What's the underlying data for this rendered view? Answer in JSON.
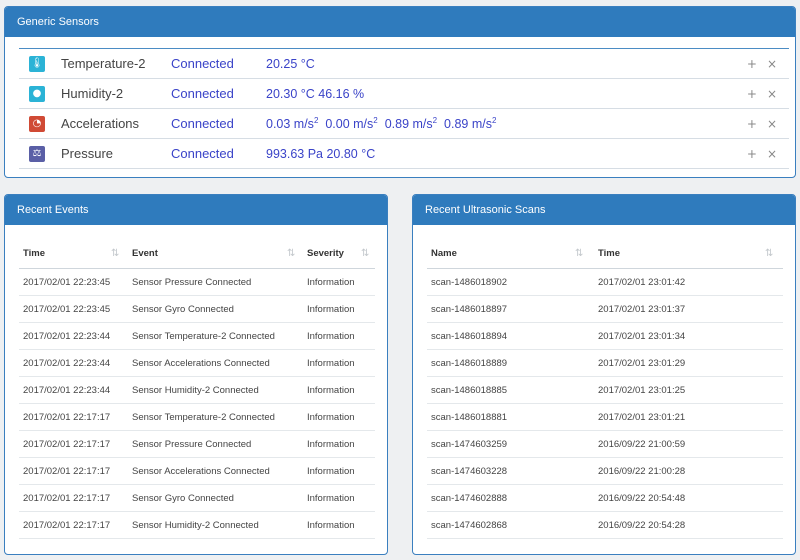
{
  "sensors_panel": {
    "title": "Generic Sensors",
    "rows": [
      {
        "name": "Temperature-2",
        "status": "Connected",
        "value": "20.25 °C",
        "icon": "thermometer-icon"
      },
      {
        "name": "Humidity-2",
        "status": "Connected",
        "value": "20.30 °C  46.16 %",
        "icon": "droplet-icon"
      },
      {
        "name": "Accelerations",
        "status": "Connected",
        "value_parts": [
          "0.03 m/s",
          "0.00 m/s",
          "0.89 m/s",
          "0.89 m/s"
        ],
        "value_sup": "2",
        "icon": "gauge-icon"
      },
      {
        "name": "Pressure",
        "status": "Connected",
        "value": "993.63 Pa  20.80 °C",
        "icon": "scale-icon"
      }
    ],
    "actions": {
      "add": "+",
      "close": "×"
    }
  },
  "events_panel": {
    "title": "Recent Events",
    "columns": [
      "Time",
      "Event",
      "Severity"
    ],
    "rows": [
      [
        "2017/02/01 22:23:45",
        "Sensor Pressure Connected",
        "Information"
      ],
      [
        "2017/02/01 22:23:45",
        "Sensor Gyro Connected",
        "Information"
      ],
      [
        "2017/02/01 22:23:44",
        "Sensor Temperature-2 Connected",
        "Information"
      ],
      [
        "2017/02/01 22:23:44",
        "Sensor Accelerations Connected",
        "Information"
      ],
      [
        "2017/02/01 22:23:44",
        "Sensor Humidity-2 Connected",
        "Information"
      ],
      [
        "2017/02/01 22:17:17",
        "Sensor Temperature-2 Connected",
        "Information"
      ],
      [
        "2017/02/01 22:17:17",
        "Sensor Pressure Connected",
        "Information"
      ],
      [
        "2017/02/01 22:17:17",
        "Sensor Accelerations Connected",
        "Information"
      ],
      [
        "2017/02/01 22:17:17",
        "Sensor Gyro Connected",
        "Information"
      ],
      [
        "2017/02/01 22:17:17",
        "Sensor Humidity-2 Connected",
        "Information"
      ]
    ]
  },
  "scans_panel": {
    "title": "Recent Ultrasonic Scans",
    "columns": [
      "Name",
      "Time"
    ],
    "rows": [
      [
        "scan-1486018902",
        "2017/02/01 23:01:42"
      ],
      [
        "scan-1486018897",
        "2017/02/01 23:01:37"
      ],
      [
        "scan-1486018894",
        "2017/02/01 23:01:34"
      ],
      [
        "scan-1486018889",
        "2017/02/01 23:01:29"
      ],
      [
        "scan-1486018885",
        "2017/02/01 23:01:25"
      ],
      [
        "scan-1486018881",
        "2017/02/01 23:01:21"
      ],
      [
        "scan-1474603259",
        "2016/09/22 21:00:59"
      ],
      [
        "scan-1474603228",
        "2016/09/22 21:00:28"
      ],
      [
        "scan-1474602888",
        "2016/09/22 20:54:48"
      ],
      [
        "scan-1474602868",
        "2016/09/22 20:54:28"
      ]
    ]
  },
  "colors": {
    "header": "#2f7bbd",
    "link": "#3a43c8"
  }
}
